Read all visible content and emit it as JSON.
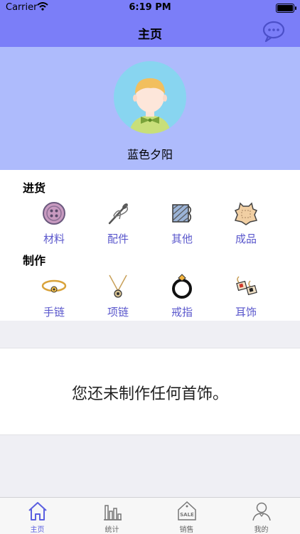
{
  "status_bar": {
    "carrier": "Carrier",
    "time": "6:19 PM"
  },
  "nav": {
    "title": "主页"
  },
  "profile": {
    "username": "蓝色夕阳"
  },
  "sections": {
    "purchase": {
      "title": "进货",
      "items": [
        {
          "label": "材料",
          "icon": "button-icon"
        },
        {
          "label": "配件",
          "icon": "needle-thread-icon"
        },
        {
          "label": "其他",
          "icon": "fabric-icon"
        },
        {
          "label": "成品",
          "icon": "leather-icon"
        }
      ]
    },
    "make": {
      "title": "制作",
      "items": [
        {
          "label": "手链",
          "icon": "bracelet-icon"
        },
        {
          "label": "项链",
          "icon": "necklace-icon"
        },
        {
          "label": "戒指",
          "icon": "ring-icon"
        },
        {
          "label": "耳饰",
          "icon": "earring-icon"
        }
      ]
    }
  },
  "empty_state": {
    "message": "您还未制作任何首饰。"
  },
  "tabs": [
    {
      "label": "主页",
      "icon": "home-icon",
      "active": true
    },
    {
      "label": "统计",
      "icon": "bar-chart-icon",
      "active": false
    },
    {
      "label": "销售",
      "icon": "sale-tag-icon",
      "active": false
    },
    {
      "label": "我的",
      "icon": "person-icon",
      "active": false
    }
  ],
  "colors": {
    "nav_bg": "#7b7ef8",
    "profile_bg": "#aebbfc",
    "label_accent": "#5a57cc",
    "tab_active": "#5b5fe0"
  }
}
